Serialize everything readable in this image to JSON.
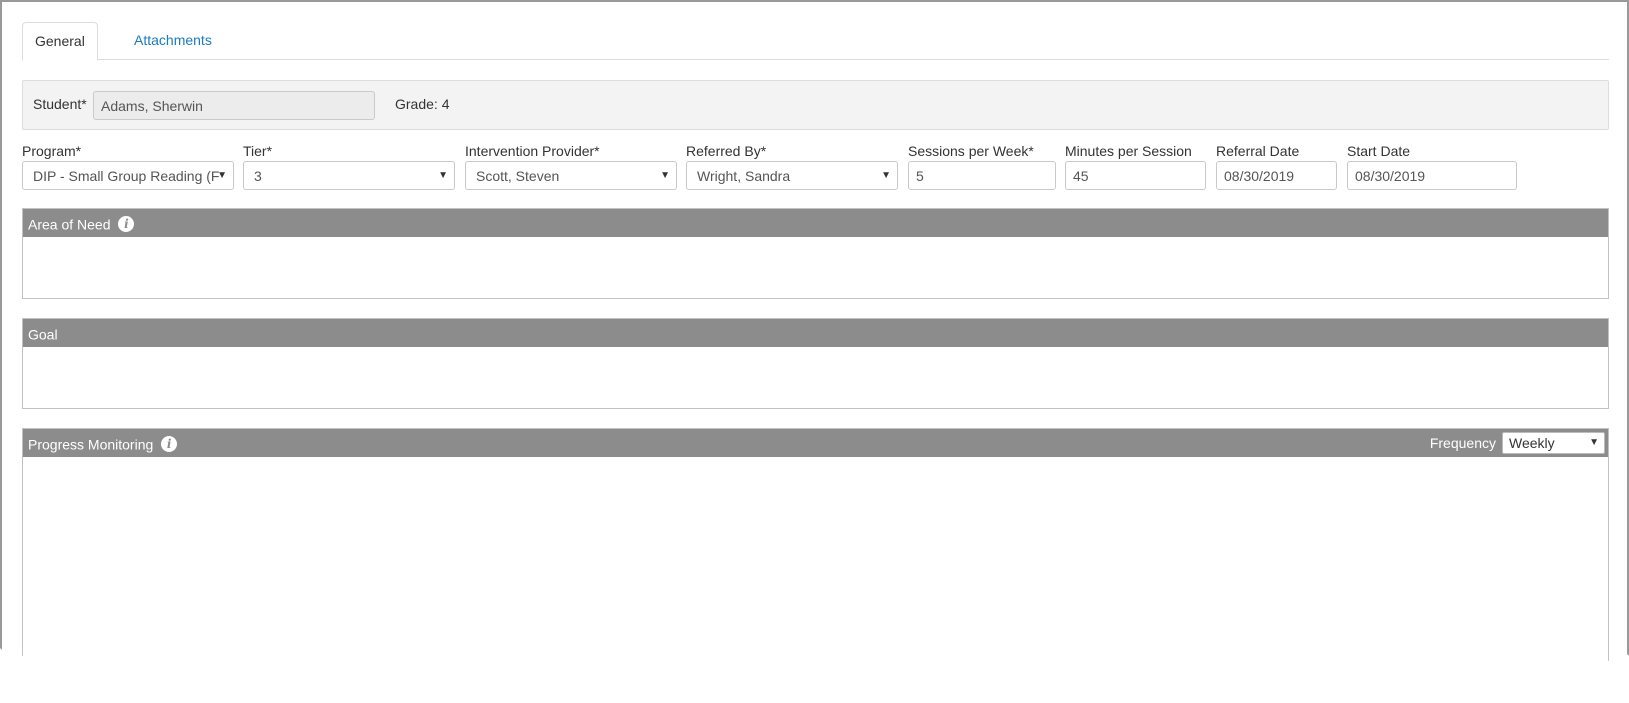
{
  "tabs": [
    {
      "label": "General",
      "active": true
    },
    {
      "label": "Attachments",
      "active": false
    }
  ],
  "student": {
    "label": "Student*",
    "value": "Adams, Sherwin",
    "grade": "Grade: 4"
  },
  "fields": {
    "program": {
      "label": "Program*",
      "value": "DIP - Small Group Reading (F"
    },
    "tier": {
      "label": "Tier*",
      "value": "3"
    },
    "provider": {
      "label": "Intervention Provider*",
      "value": "Scott, Steven"
    },
    "referred_by": {
      "label": "Referred By*",
      "value": "Wright, Sandra"
    },
    "sessions": {
      "label": "Sessions per Week*",
      "value": "5"
    },
    "minutes": {
      "label": "Minutes per Session",
      "value": "45"
    },
    "referral_date": {
      "label": "Referral Date",
      "value": "08/30/2019"
    },
    "start_date": {
      "label": "Start Date",
      "value": "08/30/2019"
    }
  },
  "panels": {
    "area_of_need": {
      "title": "Area of Need"
    },
    "goal": {
      "title": "Goal"
    },
    "progress": {
      "title": "Progress Monitoring",
      "frequency_label": "Frequency",
      "frequency_value": "Weekly"
    }
  },
  "icons": {
    "info": "info-icon",
    "caret": "chevron-down-icon"
  },
  "colors": {
    "panel_header": "#8c8c8c",
    "link": "#1a7bc1",
    "student_bar": "#f3f3f3"
  }
}
